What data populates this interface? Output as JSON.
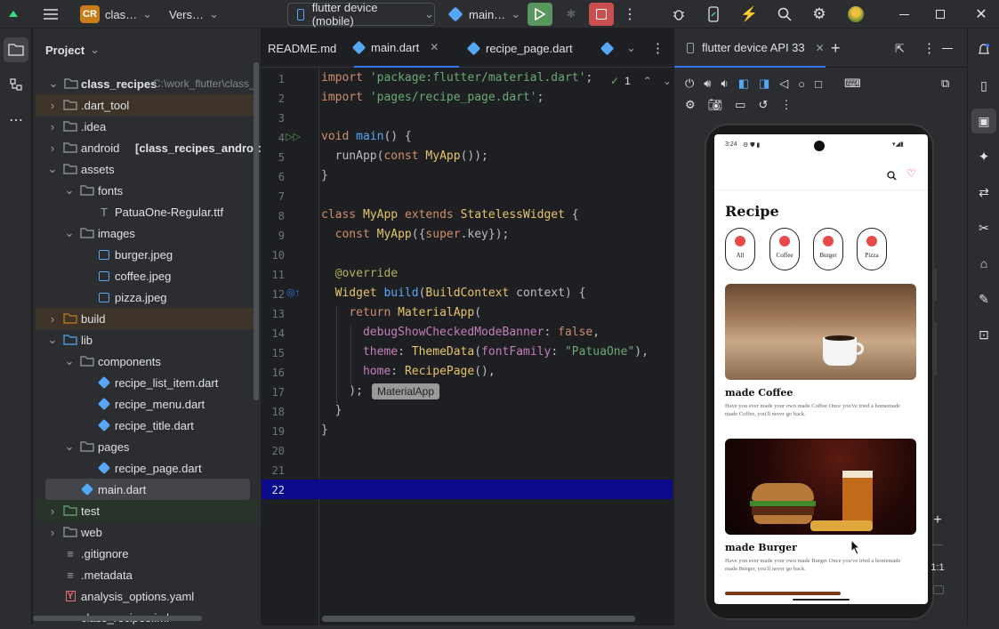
{
  "titlebar": {
    "project_badge": "CR",
    "project_name": "clas…",
    "vcs_label": "Vers…",
    "device_selector": "flutter device (mobile)",
    "run_config": "main…"
  },
  "project_panel": {
    "title": "Project",
    "root_name": "class_recipes",
    "root_path": "C:\\work_flutter\\class_",
    "items": [
      {
        "label": ".dart_tool",
        "depth": 1,
        "type": "folder",
        "expanded": false
      },
      {
        "label": ".idea",
        "depth": 1,
        "type": "folder",
        "expanded": false
      },
      {
        "label": "android",
        "module": "[class_recipes_android]",
        "depth": 1,
        "type": "folder",
        "expanded": false
      },
      {
        "label": "assets",
        "depth": 1,
        "type": "folder",
        "expanded": true
      },
      {
        "label": "fonts",
        "depth": 2,
        "type": "folder",
        "expanded": true
      },
      {
        "label": "PatuaOne-Regular.ttf",
        "depth": 3,
        "type": "font"
      },
      {
        "label": "images",
        "depth": 2,
        "type": "folder",
        "expanded": true
      },
      {
        "label": "burger.jpeg",
        "depth": 3,
        "type": "image"
      },
      {
        "label": "coffee.jpeg",
        "depth": 3,
        "type": "image"
      },
      {
        "label": "pizza.jpeg",
        "depth": 3,
        "type": "image"
      },
      {
        "label": "build",
        "depth": 1,
        "type": "folder",
        "expanded": false
      },
      {
        "label": "lib",
        "depth": 1,
        "type": "folder",
        "expanded": true
      },
      {
        "label": "components",
        "depth": 2,
        "type": "folder",
        "expanded": true
      },
      {
        "label": "recipe_list_item.dart",
        "depth": 3,
        "type": "dart"
      },
      {
        "label": "recipe_menu.dart",
        "depth": 3,
        "type": "dart"
      },
      {
        "label": "recipe_title.dart",
        "depth": 3,
        "type": "dart"
      },
      {
        "label": "pages",
        "depth": 2,
        "type": "folder",
        "expanded": true
      },
      {
        "label": "recipe_page.dart",
        "depth": 3,
        "type": "dart"
      },
      {
        "label": "main.dart",
        "depth": 2,
        "type": "dart"
      },
      {
        "label": "test",
        "depth": 1,
        "type": "folder",
        "expanded": false
      },
      {
        "label": "web",
        "depth": 1,
        "type": "folder",
        "expanded": false
      },
      {
        "label": ".gitignore",
        "depth": 1,
        "type": "file"
      },
      {
        "label": ".metadata",
        "depth": 1,
        "type": "file"
      },
      {
        "label": "analysis_options.yaml",
        "depth": 1,
        "type": "yaml"
      },
      {
        "label": "class_recipes.iml",
        "depth": 1,
        "type": "file"
      }
    ]
  },
  "editor": {
    "tabs": [
      {
        "label": "README.md"
      },
      {
        "label": "main.dart"
      },
      {
        "label": "recipe_page.dart"
      }
    ],
    "inspection_count": "1",
    "line_numbers": [
      "1",
      "2",
      "3",
      "4",
      "5",
      "6",
      "7",
      "8",
      "9",
      "10",
      "11",
      "12",
      "13",
      "14",
      "15",
      "16",
      "17",
      "18",
      "19",
      "20",
      "21",
      "22"
    ],
    "inline_hint": "MaterialApp"
  },
  "device_panel": {
    "tab_label": "flutter device API 33",
    "status_time": "3:24",
    "app_title": "Recipe",
    "categories": [
      "All",
      "Coffee",
      "Burger",
      "Pizza"
    ],
    "recipes": [
      {
        "title": "made Coffee",
        "desc": "Have you ever made your own made Coffee Once you've tried a homemade made Coffee, you'll never go back."
      },
      {
        "title": "made Burger",
        "desc": "Have you ever made your own made Burger Once you've tried a homemade made Burger, you'll never go back."
      }
    ],
    "zoom_label": "1:1"
  }
}
